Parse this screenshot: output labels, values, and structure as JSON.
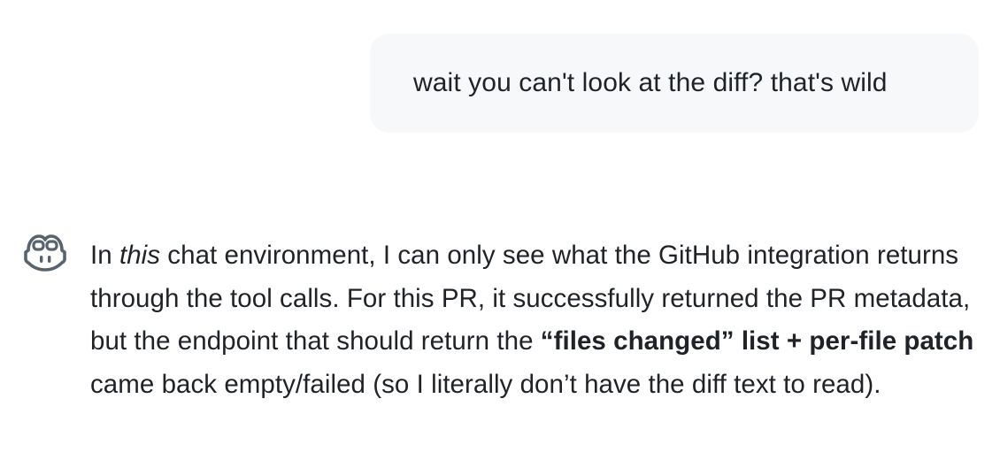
{
  "user_message": {
    "text": "wait you can't look at the diff? that's wild"
  },
  "assistant_message": {
    "icon": "copilot-icon",
    "segments": [
      {
        "text": "In ",
        "style": "normal"
      },
      {
        "text": "this",
        "style": "italic"
      },
      {
        "text": " chat environment, I can only see what the GitHub integration returns through the tool calls. For this PR, it successfully returned the PR metadata, but the endpoint that should return the ",
        "style": "normal"
      },
      {
        "text": "“files changed” list + per-file patch",
        "style": "bold"
      },
      {
        "text": " came back empty/failed (so I literally don’t have the diff text to read).",
        "style": "normal"
      }
    ]
  }
}
